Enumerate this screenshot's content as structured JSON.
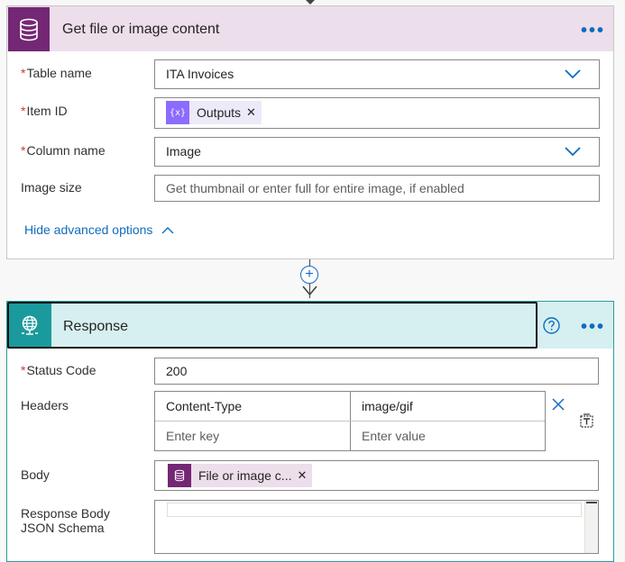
{
  "card1": {
    "title": "Get file or image content",
    "icon": "database-icon",
    "brand_color": "#742774",
    "fields": {
      "table_name": {
        "label": "Table name",
        "required": "*",
        "value": "ITA Invoices"
      },
      "item_id": {
        "label": "Item ID",
        "required": "*",
        "token": "Outputs",
        "token_icon": "expression-icon"
      },
      "column_name": {
        "label": "Column name",
        "required": "*",
        "value": "Image"
      },
      "image_size": {
        "label": "Image size",
        "placeholder": "Get thumbnail or enter full for entire image, if enabled"
      }
    },
    "advanced_link": "Hide advanced options"
  },
  "card2": {
    "title": "Response",
    "icon": "globe-icon",
    "brand_color": "#1a9a9c",
    "fields": {
      "status_code": {
        "label": "Status Code",
        "required": "*",
        "value": "200"
      },
      "headers": {
        "label": "Headers",
        "key": "Content-Type",
        "value": "image/gif",
        "key_placeholder": "Enter key",
        "value_placeholder": "Enter value"
      },
      "body": {
        "label": "Body",
        "token": "File or image c...",
        "token_icon": "database-icon"
      },
      "schema": {
        "label": "Response Body JSON Schema"
      }
    }
  }
}
